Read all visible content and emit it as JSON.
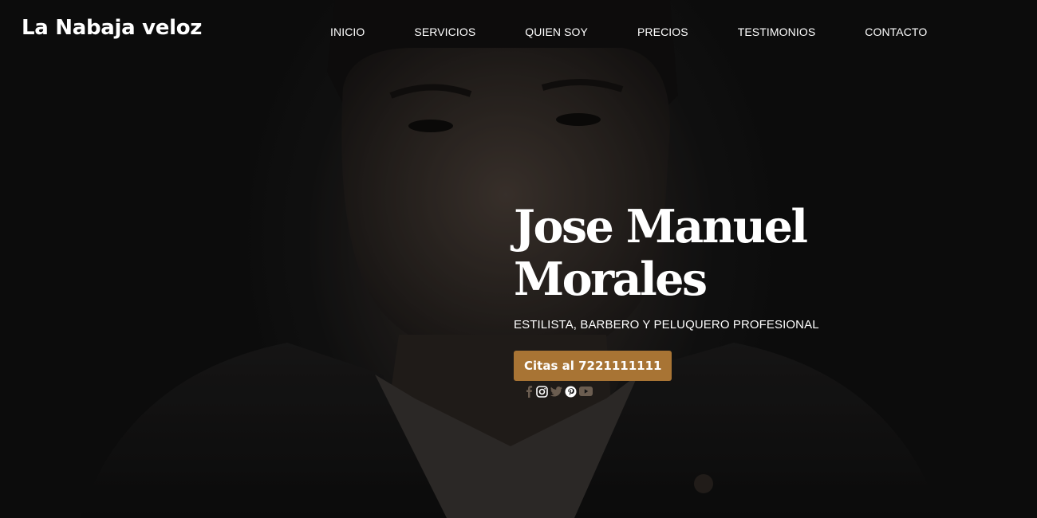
{
  "header": {
    "brand": "La Nabaja veloz",
    "nav": [
      "INICIO",
      "SERVICIOS",
      "QUIEN SOY",
      "PRECIOS",
      "TESTIMONIOS",
      "CONTACTO"
    ]
  },
  "hero": {
    "title_line1": "Jose Manuel",
    "title_line2": "Morales",
    "subtitle": "ESTILISTA, BARBERO Y PELUQUERO PROFESIONAL",
    "cta_label": "Citas al 7221111111"
  },
  "social_icons": [
    "facebook-icon",
    "instagram-icon",
    "twitter-icon",
    "pinterest-icon",
    "youtube-icon"
  ],
  "colors": {
    "accent": "#a87434",
    "background": "#141414",
    "text": "#ffffff",
    "muted_icon": "#6b5d50"
  }
}
